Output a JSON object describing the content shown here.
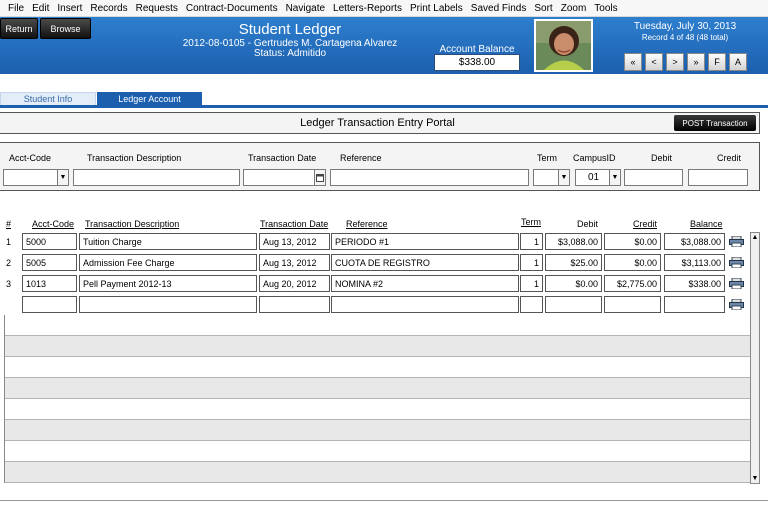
{
  "menu": [
    "File",
    "Edit",
    "Insert",
    "Records",
    "Requests",
    "Contract-Documents",
    "Navigate",
    "Letters-Reports",
    "Print Labels",
    "Saved Finds",
    "Sort",
    "Zoom",
    "Tools"
  ],
  "header": {
    "return_label": "Return",
    "browse_label": "Browse",
    "title": "Student Ledger",
    "student_line": "2012-08-0105 - Gertrudes M. Cartagena Alvarez",
    "status_line": "Status: Admitido",
    "balance_label": "Account Balance",
    "balance_value": "$338.00",
    "date": "Tuesday, July 30, 2013",
    "record_info": "Record 4 of 48 (48 total)",
    "nav_buttons": [
      "«",
      "<",
      ">",
      "»",
      "F",
      "A"
    ]
  },
  "tabs": [
    "Student Info",
    "Ledger Account"
  ],
  "subbar": {
    "title": "Ledger  Transaction  Entry  Portal",
    "post_label": "POST Transaction"
  },
  "entry": {
    "labels": {
      "acct": "Acct-Code",
      "desc": "Transaction Description",
      "date": "Transaction Date",
      "ref": "Reference",
      "term": "Term",
      "campus": "CampusID",
      "debit": "Debit",
      "credit": "Credit"
    },
    "campus_value": "01"
  },
  "table": {
    "headers": {
      "num": "#",
      "acct": "Acct-Code",
      "desc": "Transaction Description",
      "date": "Transaction Date",
      "ref": "Reference",
      "term": "Term",
      "debit": "Debit",
      "credit": "Credit",
      "balance": "Balance"
    },
    "rows": [
      {
        "num": "1",
        "acct": "5000",
        "desc": "Tuition Charge",
        "date": "Aug 13, 2012",
        "ref": "PERIODO #1",
        "term": "1",
        "debit": "$3,088.00",
        "credit": "$0.00",
        "balance": "$3,088.00"
      },
      {
        "num": "2",
        "acct": "5005",
        "desc": "Admission Fee Charge",
        "date": "Aug 13, 2012",
        "ref": "CUOTA DE REGISTRO",
        "term": "1",
        "debit": "$25.00",
        "credit": "$0.00",
        "balance": "$3,113.00"
      },
      {
        "num": "3",
        "acct": "1013",
        "desc": "Pell Payment 2012-13",
        "date": "Aug 20, 2012",
        "ref": "NOMINA #2",
        "term": "1",
        "debit": "$0.00",
        "credit": "$2,775.00",
        "balance": "$338.00"
      }
    ]
  },
  "icons": {
    "printer": "printer-icon",
    "calendar": "calendar-icon",
    "dropdown": "dropdown-arrow-icon"
  },
  "colors": {
    "header_blue": "#1b5fae",
    "tab_active": "#1b5fae",
    "button_black": "#111111"
  }
}
